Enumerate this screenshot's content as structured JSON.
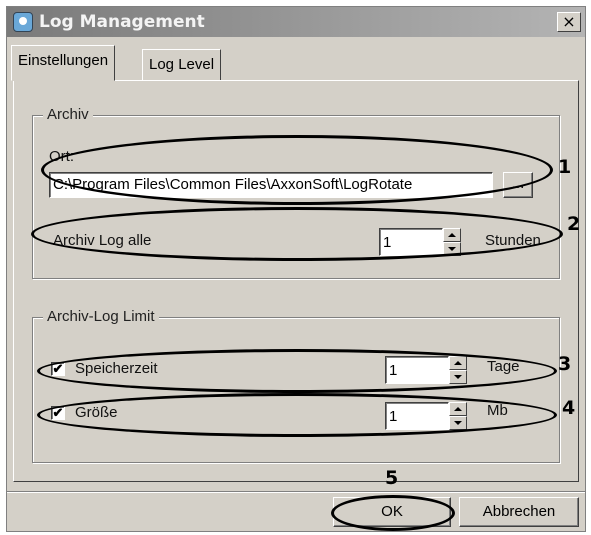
{
  "window": {
    "title": "Log Management",
    "close_symbol": "×"
  },
  "tabs": [
    {
      "label": "Einstellungen",
      "active": true
    },
    {
      "label": "Log Level",
      "active": false
    }
  ],
  "archive": {
    "group_title": "Archiv",
    "location_label": "Ort:",
    "location_value": "C:\\Program Files\\Common Files\\AxxonSoft\\LogRotate",
    "browse_label": "...",
    "interval_label": "Archiv Log alle",
    "interval_value": "1",
    "interval_unit": "Stunden"
  },
  "limit": {
    "group_title": "Archiv-Log Limit",
    "storage_time": {
      "checked": true,
      "label": "Speicherzeit",
      "value": "1",
      "unit": "Tage"
    },
    "size": {
      "checked": true,
      "label": "Größe",
      "value": "1",
      "unit": "Mb"
    }
  },
  "buttons": {
    "ok": "OK",
    "cancel": "Abbrechen"
  },
  "check_mark": "✔",
  "markers": [
    "1",
    "2",
    "3",
    "4",
    "5"
  ]
}
